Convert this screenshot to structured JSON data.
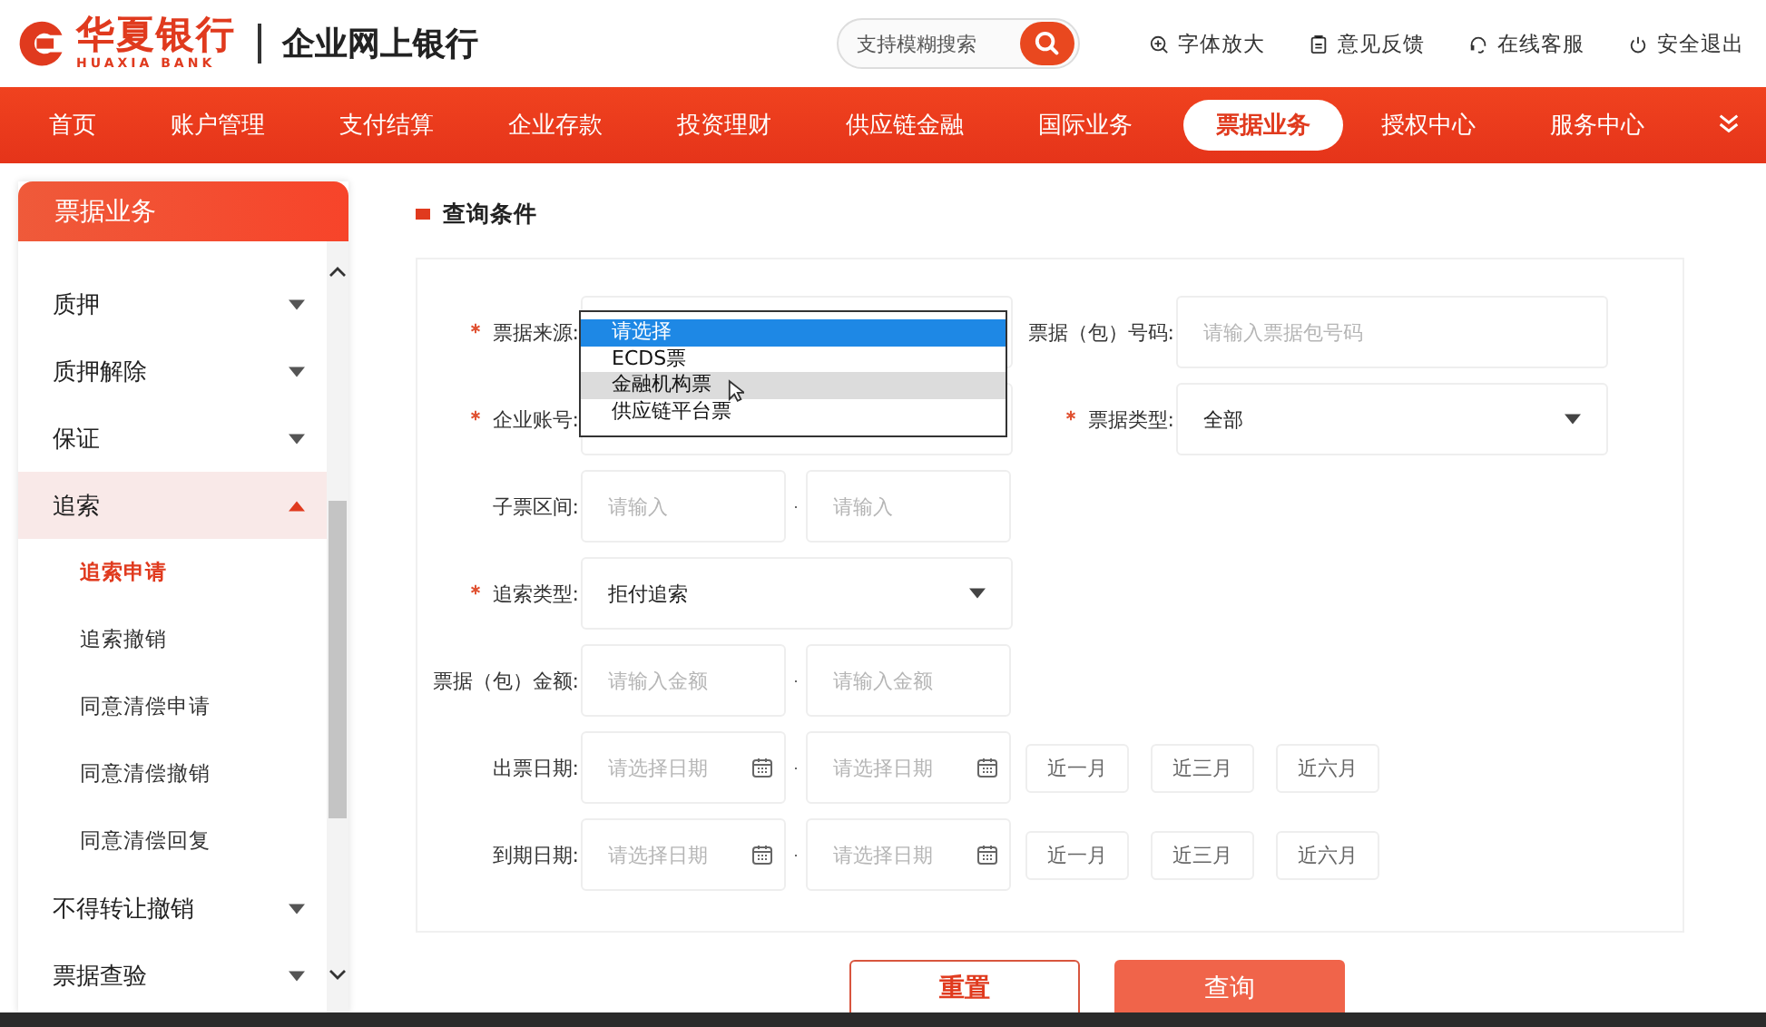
{
  "header": {
    "bank_name": "华夏银行",
    "bank_name_en": "HUAXIA BANK",
    "product": "企业网上银行",
    "search": {
      "placeholder": "支持模糊搜索"
    },
    "tools": [
      {
        "label": "字体放大"
      },
      {
        "label": "意见反馈"
      },
      {
        "label": "在线客服"
      },
      {
        "label": "安全退出"
      }
    ]
  },
  "nav": {
    "items": [
      {
        "label": "首页",
        "selected": false
      },
      {
        "label": "账户管理",
        "selected": false
      },
      {
        "label": "支付结算",
        "selected": false
      },
      {
        "label": "企业存款",
        "selected": false
      },
      {
        "label": "投资理财",
        "selected": false
      },
      {
        "label": "供应链金融",
        "selected": false
      },
      {
        "label": "国际业务",
        "selected": false
      },
      {
        "label": "票据业务",
        "selected": true
      },
      {
        "label": "授权中心",
        "selected": false
      },
      {
        "label": "服务中心",
        "selected": false
      }
    ]
  },
  "sidebar": {
    "title": "票据业务",
    "items": [
      {
        "label": "质押",
        "expanded": false,
        "selected": false
      },
      {
        "label": "质押解除",
        "expanded": false,
        "selected": false
      },
      {
        "label": "保证",
        "expanded": false,
        "selected": false
      },
      {
        "label": "追索",
        "expanded": true,
        "selected": true,
        "children": [
          {
            "label": "追索申请",
            "selected": true
          },
          {
            "label": "追索撤销",
            "selected": false
          },
          {
            "label": "同意清偿申请",
            "selected": false
          },
          {
            "label": "同意清偿撤销",
            "selected": false
          },
          {
            "label": "同意清偿回复",
            "selected": false
          }
        ]
      },
      {
        "label": "不得转让撤销",
        "expanded": false,
        "selected": false
      },
      {
        "label": "票据查验",
        "expanded": false,
        "selected": false
      }
    ]
  },
  "form": {
    "title": "查询条件",
    "rows": [
      {
        "fields": [
          {
            "kind": "select",
            "label": "票据来源:",
            "required": true
          },
          {
            "kind": "input",
            "label": "票据（包）号码:",
            "required": false,
            "placeholder": "请输入票据包号码"
          }
        ]
      },
      {
        "fields": [
          {
            "kind": "select",
            "label": "企业账号:",
            "required": true
          },
          {
            "kind": "select",
            "label": "票据类型:",
            "required": true,
            "value": "全部"
          }
        ]
      },
      {
        "fields": [
          {
            "kind": "range",
            "label": "子票区间:",
            "required": false,
            "from": {
              "placeholder": "请输入"
            },
            "to": {
              "placeholder": "请输入"
            }
          }
        ]
      },
      {
        "fields": [
          {
            "kind": "select",
            "label": "追索类型:",
            "required": true,
            "value": "拒付追索"
          }
        ]
      },
      {
        "fields": [
          {
            "kind": "range",
            "label": "票据（包）金额:",
            "required": false,
            "from": {
              "placeholder": "请输入金额"
            },
            "to": {
              "placeholder": "请输入金额"
            }
          }
        ]
      },
      {
        "fields": [
          {
            "kind": "date_range",
            "label": "出票日期:",
            "required": false,
            "from": {
              "placeholder": "请选择日期"
            },
            "to": {
              "placeholder": "请选择日期"
            },
            "quick": [
              "近一月",
              "近三月",
              "近六月"
            ]
          }
        ]
      },
      {
        "fields": [
          {
            "kind": "date_range",
            "label": "到期日期:",
            "required": false,
            "from": {
              "placeholder": "请选择日期"
            },
            "to": {
              "placeholder": "请选择日期"
            },
            "quick": [
              "近一月",
              "近三月",
              "近六月"
            ]
          }
        ]
      }
    ],
    "dropdown": {
      "options": [
        {
          "label": "请选择",
          "selected": true,
          "hovered": false
        },
        {
          "label": "ECDS票",
          "selected": false,
          "hovered": false
        },
        {
          "label": "金融机构票",
          "selected": false,
          "hovered": true
        },
        {
          "label": "供应链平台票",
          "selected": false,
          "hovered": false
        }
      ]
    },
    "buttons": [
      {
        "label": "重置",
        "kind": "secondary"
      },
      {
        "label": "查询",
        "kind": "primary"
      }
    ]
  }
}
